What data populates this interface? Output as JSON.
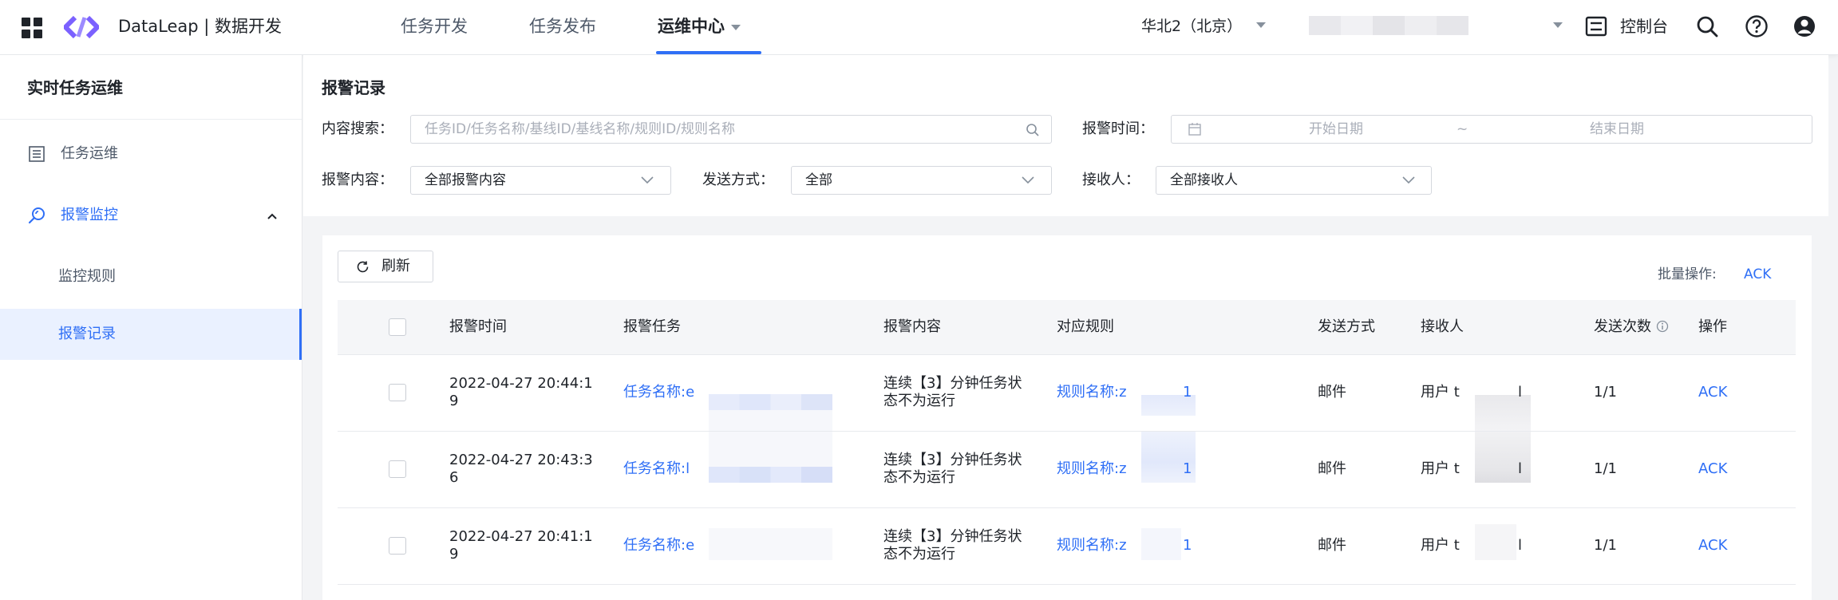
{
  "topbar": {
    "brand": "DataLeap | 数据开发",
    "nav": [
      {
        "label": "任务开发"
      },
      {
        "label": "任务发布"
      },
      {
        "label": "运维中心"
      }
    ],
    "region": "华北2（北京）",
    "console_label": "控制台"
  },
  "sidebar": {
    "title": "实时任务运维",
    "items": [
      {
        "label": "任务运维"
      },
      {
        "label": "报警监控"
      },
      {
        "label": "监控规则"
      },
      {
        "label": "报警记录"
      }
    ]
  },
  "filters": {
    "page_title": "报警记录",
    "search_label": "内容搜索：",
    "search_placeholder": "任务ID/任务名称/基线ID/基线名称/规则ID/规则名称",
    "time_label": "报警时间：",
    "start_placeholder": "开始日期",
    "range_sep": "~",
    "end_placeholder": "结束日期",
    "content_label": "报警内容：",
    "content_value": "全部报警内容",
    "method_label": "发送方式：",
    "method_value": "全部",
    "receiver_label": "接收人：",
    "receiver_value": "全部接收人"
  },
  "toolbar": {
    "refresh_label": "刷新",
    "batch_label": "批量操作:",
    "batch_ack": "ACK"
  },
  "table": {
    "columns": [
      "报警时间",
      "报警任务",
      "报警内容",
      "对应规则",
      "发送方式",
      "接收人",
      "发送次数",
      "操作"
    ],
    "rows": [
      {
        "time_line1": "2022-04-27 20:44:1",
        "time_line2": "9",
        "task": "任务名称:e",
        "content_line1": "连续【3】分钟任务状",
        "content_line2": "态不为运行",
        "rule": "规则名称:z",
        "rule_suffix": "1",
        "method": "邮件",
        "receiver": "用户 t",
        "receiver_suffix": "l",
        "count": "1/1",
        "action": "ACK"
      },
      {
        "time_line1": "2022-04-27 20:43:3",
        "time_line2": "6",
        "task": "任务名称:l",
        "content_line1": "连续【3】分钟任务状",
        "content_line2": "态不为运行",
        "rule": "规则名称:z",
        "rule_suffix": "1",
        "method": "邮件",
        "receiver": "用户 t",
        "receiver_suffix": "l",
        "count": "1/1",
        "action": "ACK"
      },
      {
        "time_line1": "2022-04-27 20:41:1",
        "time_line2": "9",
        "task": "任务名称:e",
        "content_line1": "连续【3】分钟任务状",
        "content_line2": "态不为运行",
        "rule": "规则名称:z",
        "rule_suffix": "1",
        "method": "邮件",
        "receiver": "用户 t",
        "receiver_suffix": "l",
        "count": "1/1",
        "action": "ACK"
      }
    ]
  },
  "colors": {
    "accent": "#2f6ff6",
    "logo": "#7b61ff",
    "text": "#1f2329",
    "muted": "#4e5969"
  },
  "icons": [
    "apps-grid-icon",
    "dataleap-logo-icon",
    "console-icon",
    "search-icon",
    "help-icon",
    "user-avatar-icon",
    "list-icon",
    "alarm-search-icon",
    "calendar-icon",
    "refresh-icon",
    "info-icon"
  ]
}
